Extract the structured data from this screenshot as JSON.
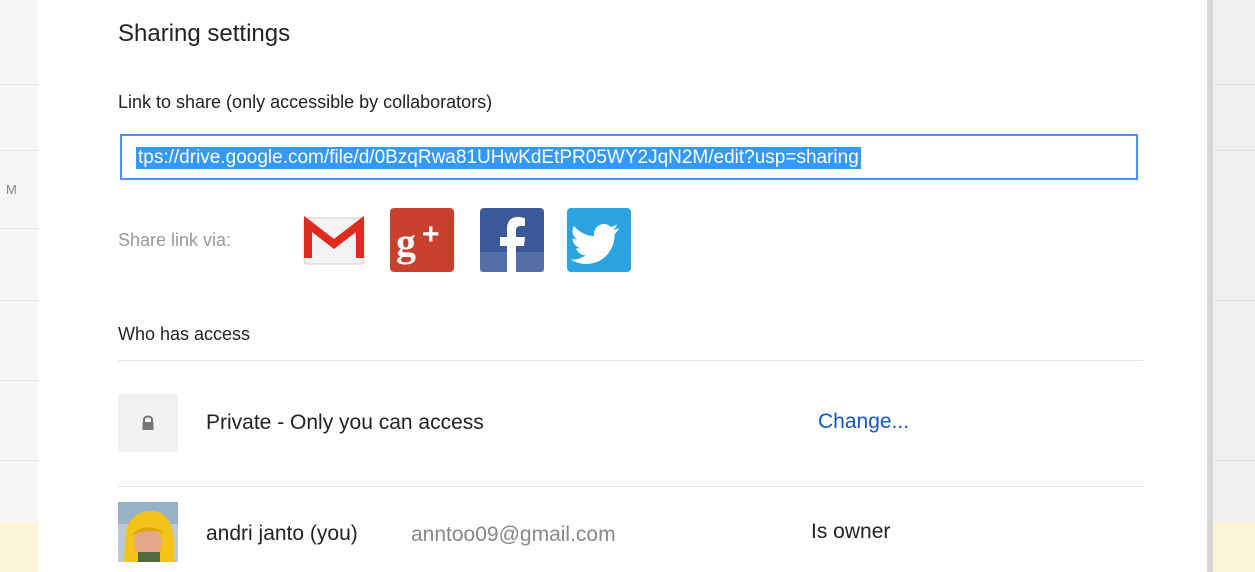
{
  "dialog": {
    "title": "Sharing settings",
    "link_label": "Link to share (only accessible by collaborators)",
    "link_value": "tps://drive.google.com/file/d/0BzqRwa81UHwKdEtPR05WY2JqN2M/edit?usp=sharing",
    "share_via_label": "Share link via:",
    "share_services": [
      {
        "name": "Gmail",
        "icon": "gmail-icon",
        "color": "#dd4b39"
      },
      {
        "name": "Google+",
        "icon": "google-plus-icon",
        "color": "#c8402e"
      },
      {
        "name": "Facebook",
        "icon": "facebook-icon",
        "color": "#3b5998"
      },
      {
        "name": "Twitter",
        "icon": "twitter-icon",
        "color": "#2aa3e0"
      }
    ],
    "access_heading": "Who has access",
    "privacy": {
      "icon": "lock-icon",
      "label": "Private - Only you can access",
      "change_label": "Change..."
    },
    "owner": {
      "name": "andri janto (you)",
      "email": "anntoo09@gmail.com",
      "role": "Is owner"
    }
  },
  "colors": {
    "accent": "#4d90fe",
    "selection": "#3399ff",
    "link": "#1155cc"
  }
}
